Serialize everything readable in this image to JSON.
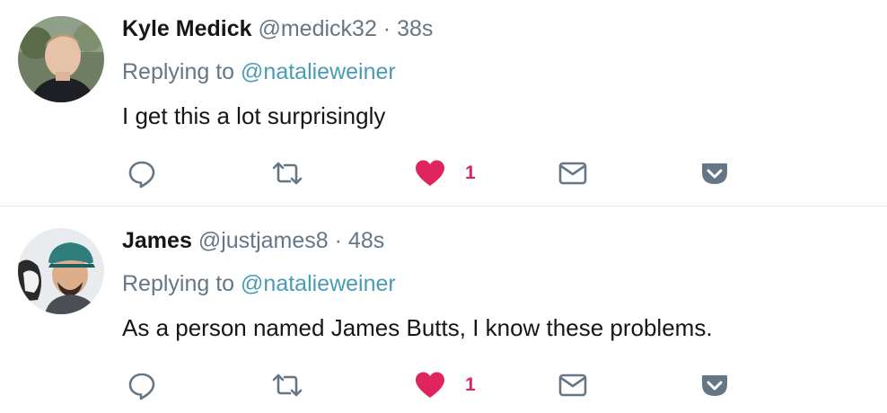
{
  "colors": {
    "text_primary": "#14171a",
    "text_secondary": "#657786",
    "mention": "#4a9bb5",
    "like": "#e0245e",
    "icon": "#657786",
    "divider": "#e1e8ed"
  },
  "tweets": [
    {
      "name": "Kyle Medick",
      "handle": "@medick32",
      "separator": "·",
      "time": "38s",
      "replying_prefix": "Replying to",
      "replying_to": "@natalieweiner",
      "text": "I get this a lot surprisingly",
      "like_count": "1",
      "liked": true,
      "icons": {
        "reply": "reply-icon",
        "retweet": "retweet-icon",
        "like": "heart-icon",
        "dm": "envelope-icon",
        "more": "chevron-down-icon"
      }
    },
    {
      "name": "James",
      "handle": "@justjames8",
      "separator": "·",
      "time": "48s",
      "replying_prefix": "Replying to",
      "replying_to": "@natalieweiner",
      "text": "As a person named James Butts, I know these problems.",
      "like_count": "1",
      "liked": true,
      "icons": {
        "reply": "reply-icon",
        "retweet": "retweet-icon",
        "like": "heart-icon",
        "dm": "envelope-icon",
        "more": "chevron-down-icon"
      }
    }
  ]
}
